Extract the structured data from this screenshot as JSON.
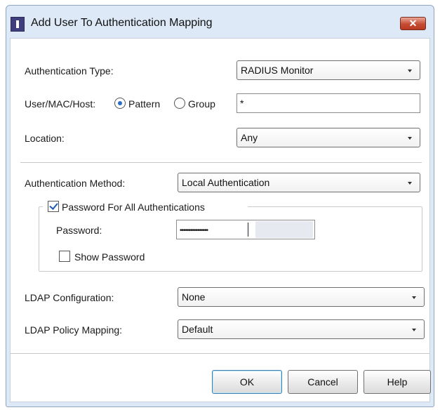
{
  "window": {
    "title": "Add User To Authentication Mapping",
    "close_label": "✕"
  },
  "form": {
    "auth_type": {
      "label": "Authentication Type:",
      "value": "RADIUS Monitor"
    },
    "user_mac_host": {
      "label": "User/MAC/Host:",
      "options": [
        {
          "label": "Pattern",
          "checked": true
        },
        {
          "label": "Group",
          "checked": false
        }
      ],
      "value": "*"
    },
    "location": {
      "label": "Location:",
      "value": "Any"
    },
    "auth_method": {
      "label": "Authentication Method:",
      "value": "Local Authentication"
    },
    "password_group": {
      "checkbox_label": "Password For All Authentications",
      "checked": true,
      "password_label": "Password:",
      "password_value": "••••••••••••••••",
      "show_password_label": "Show Password",
      "show_password_checked": false
    },
    "ldap_config": {
      "label": "LDAP Configuration:",
      "value": "None"
    },
    "ldap_policy": {
      "label": "LDAP Policy Mapping:",
      "value": "Default"
    }
  },
  "buttons": {
    "ok": "OK",
    "cancel": "Cancel",
    "help": "Help"
  },
  "colors": {
    "title_bg": "#dde9f7",
    "close_button": "#c64c35",
    "check_accent": "#1e5bb0"
  }
}
